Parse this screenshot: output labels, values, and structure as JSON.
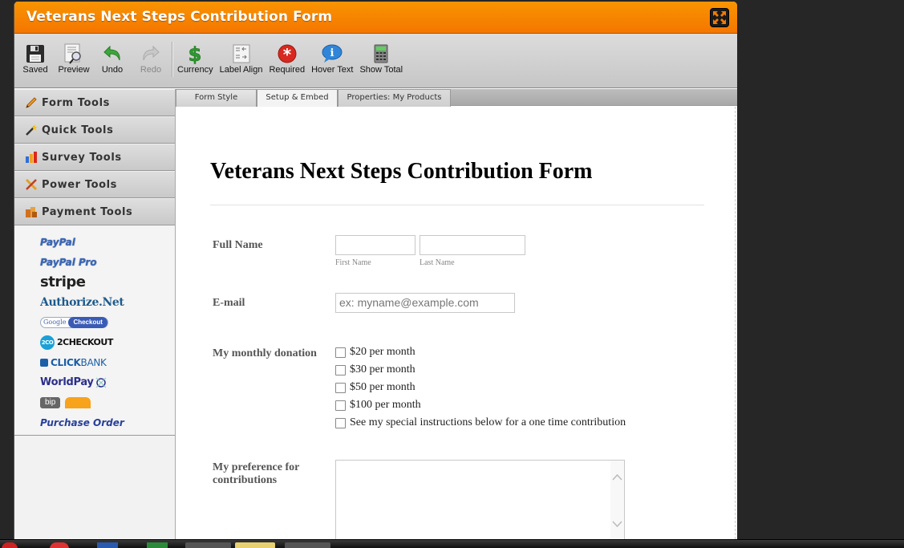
{
  "window": {
    "title": "Veterans Next Steps Contribution Form",
    "accent_color": "#f57f00"
  },
  "toolbar": {
    "buttons": [
      {
        "label": "Saved",
        "icon": "floppy-disk-icon",
        "enabled": true
      },
      {
        "label": "Preview",
        "icon": "preview-icon",
        "enabled": true
      },
      {
        "label": "Undo",
        "icon": "undo-icon",
        "enabled": true
      },
      {
        "label": "Redo",
        "icon": "redo-icon",
        "enabled": false
      },
      {
        "label": "Currency",
        "icon": "dollar-icon",
        "enabled": true
      },
      {
        "label": "Label Align",
        "icon": "label-align-icon",
        "enabled": true
      },
      {
        "label": "Required",
        "icon": "required-asterisk-icon",
        "enabled": true
      },
      {
        "label": "Hover Text",
        "icon": "info-bubble-icon",
        "enabled": true
      },
      {
        "label": "Show Total",
        "icon": "calculator-icon",
        "enabled": true
      }
    ]
  },
  "tabs": [
    {
      "label": "Form Style"
    },
    {
      "label": "Setup & Embed"
    },
    {
      "label": "Properties: My Products"
    }
  ],
  "sidebar": {
    "sections": [
      {
        "label": "Form Tools",
        "icon": "pencil-icon"
      },
      {
        "label": "Quick Tools",
        "icon": "magic-wand-icon"
      },
      {
        "label": "Survey Tools",
        "icon": "bar-chart-icon"
      },
      {
        "label": "Power Tools",
        "icon": "tools-icon"
      },
      {
        "label": "Payment Tools",
        "icon": "coins-icon"
      }
    ],
    "payment_options": {
      "paypal": "PayPal",
      "paypal_pro": "PayPal Pro",
      "stripe": "stripe",
      "authorize_net": "Authorize.Net",
      "google_checkout_a": "Google",
      "google_checkout_b": "Checkout",
      "twocheckout_badge": "2CO",
      "twocheckout": "2CHECKOUT",
      "clickbank_a": "CLICK",
      "clickbank_b": "BANK",
      "worldpay": "WorldPay",
      "onebip": "bip",
      "purchase_order": "Purchase Order"
    }
  },
  "form": {
    "heading": "Veterans Next Steps Contribution Form",
    "full_name": {
      "label": "Full Name",
      "first_value": "",
      "last_value": "",
      "first_sublabel": "First Name",
      "last_sublabel": "Last Name"
    },
    "email": {
      "label": "E-mail",
      "placeholder": "ex: myname@example.com"
    },
    "donation": {
      "label": "My monthly donation",
      "options": [
        {
          "label": "$20 per month",
          "checked": false
        },
        {
          "label": "$30 per month",
          "checked": false
        },
        {
          "label": "$50 per month",
          "checked": false
        },
        {
          "label": "$100 per month",
          "checked": false
        },
        {
          "label": "See my special instructions below for a one time contribution",
          "checked": false
        }
      ]
    },
    "preference": {
      "label_line1": "My preference for",
      "label_line2": "contributions",
      "value": ""
    }
  }
}
